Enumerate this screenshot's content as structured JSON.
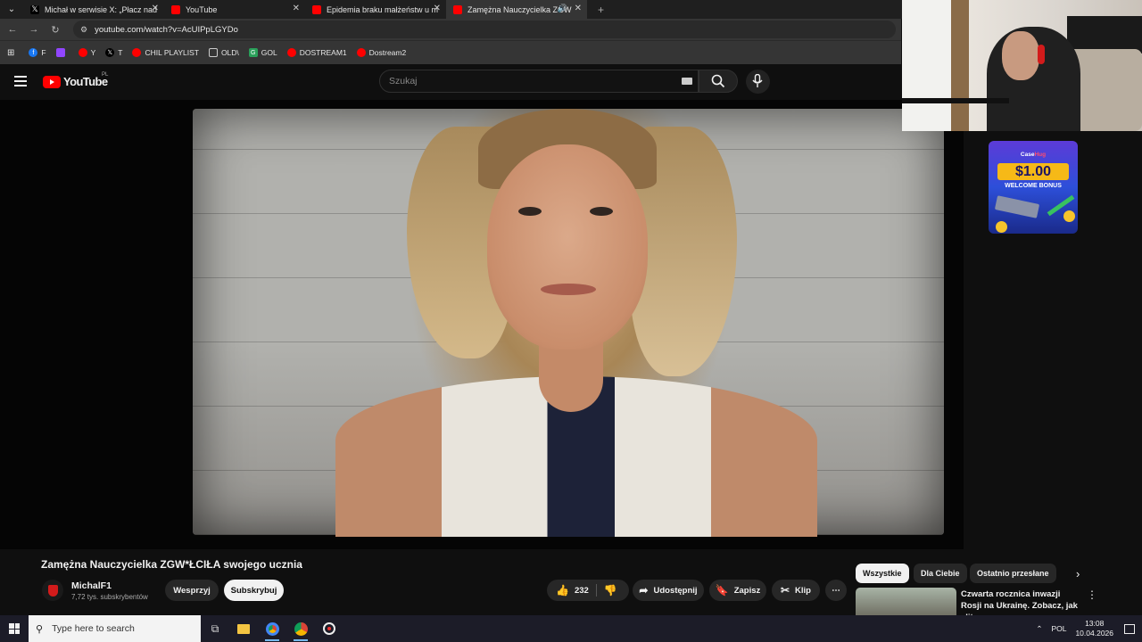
{
  "tabs": [
    {
      "label": "Michał w serwisie X: „Płacz nad",
      "icon": "x-icon",
      "active": false
    },
    {
      "label": "YouTube",
      "icon": "youtube-icon",
      "active": false
    },
    {
      "label": "Epidemia braku małżeństw u m",
      "icon": "youtube-icon",
      "active": false
    },
    {
      "label": "Zamężna Nauczycielka ZGW",
      "icon": "youtube-icon",
      "active": true
    }
  ],
  "address": {
    "url": "youtube.com/watch?v=AcUIPpLGYDo"
  },
  "bookmarks": [
    {
      "label": "F",
      "icon": "facebook-icon"
    },
    {
      "label": "",
      "icon": "twitch-icon"
    },
    {
      "label": "Y",
      "icon": "youtube-icon"
    },
    {
      "label": "T",
      "icon": "x-icon"
    },
    {
      "label": "CHIL PLAYLIST",
      "icon": "youtube-icon"
    },
    {
      "label": "OLD\\",
      "icon": "folder-icon"
    },
    {
      "label": "GOL",
      "icon": "gol-icon"
    },
    {
      "label": "DOSTREAM1",
      "icon": "youtube-icon"
    },
    {
      "label": "Dostream2",
      "icon": "youtube-icon"
    }
  ],
  "youtube": {
    "logo": "YouTube",
    "region": "PL",
    "search_placeholder": "Szukaj"
  },
  "ad": {
    "brand_a": "Case",
    "brand_b": "Hug",
    "amount": "$1.00",
    "label": "WELCOME BONUS"
  },
  "video": {
    "title": "Zamężna Nauczycielka ZGW*ŁCIŁA swojego ucznia",
    "channel": "MichalF1",
    "subscribers": "7,72 tys. subskrybentów",
    "support_label": "Wesprzyj",
    "subscribe_label": "Subskrybuj",
    "likes": "232",
    "share_label": "Udostępnij",
    "save_label": "Zapisz",
    "clip_label": "Klip"
  },
  "chips": [
    "Wszystkie",
    "Dla Ciebie",
    "Ostatnio przesłane"
  ],
  "related": [
    {
      "title": "Czwarta rocznica inwazji Rosji na Ukrainę. Zobacz, jak elitarn..."
    }
  ],
  "taskbar": {
    "search_placeholder": "Type here to search",
    "language": "POL",
    "time": "13:08",
    "date": "10.04.2026"
  }
}
